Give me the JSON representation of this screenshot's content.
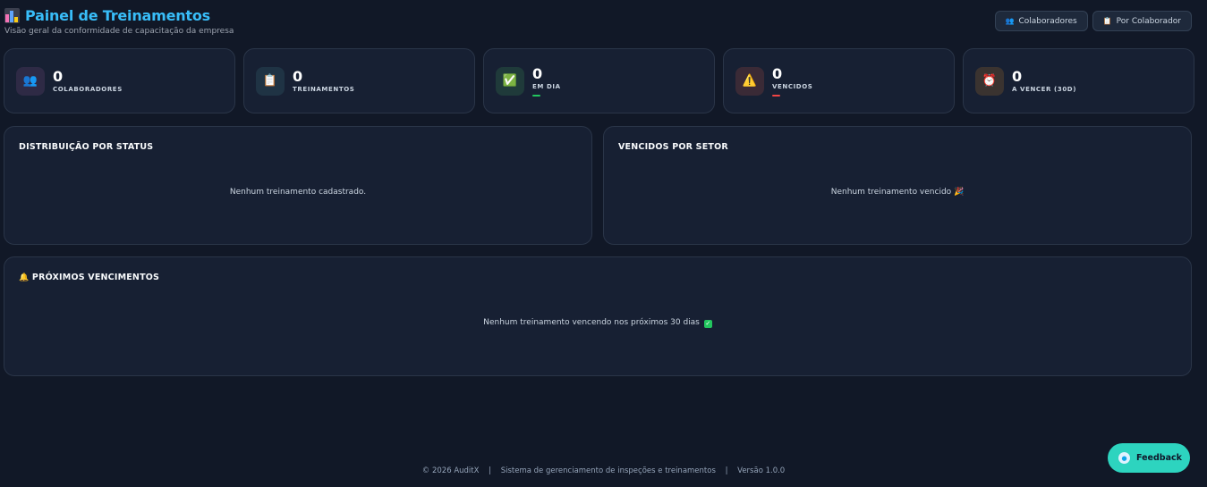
{
  "header": {
    "title": "Painel de Treinamentos",
    "subtitle": "Visão geral da conformidade de capacitação da empresa",
    "title_icon": "bar-chart-icon"
  },
  "actions": [
    {
      "label": "Colaboradores",
      "icon": "people-icon"
    },
    {
      "label": "Por Colaborador",
      "icon": "clipboard-icon"
    }
  ],
  "stats": [
    {
      "value": "0",
      "label": "COLABORADORES",
      "icon": "people-icon",
      "icon_glyph": "👥",
      "icon_bg": "#2e2a45",
      "bar_color": ""
    },
    {
      "value": "0",
      "label": "TREINAMENTOS",
      "icon": "clipboard-icon",
      "icon_glyph": "📋",
      "icon_bg": "#1f3344",
      "bar_color": ""
    },
    {
      "value": "0",
      "label": "EM DIA",
      "icon": "check-icon",
      "icon_glyph": "✅",
      "icon_bg": "#1f3a3a",
      "bar_color": "#22c55e"
    },
    {
      "value": "0",
      "label": "VENCIDOS",
      "icon": "warning-icon",
      "icon_glyph": "⚠️",
      "icon_bg": "#3a2a36",
      "bar_color": "#ef4444"
    },
    {
      "value": "0",
      "label": "A VENCER (30D)",
      "icon": "alarm-clock-icon",
      "icon_glyph": "⏰",
      "icon_bg": "#3a3330",
      "bar_color": ""
    }
  ],
  "panels": {
    "status": {
      "title": "DISTRIBUIÇÃO POR STATUS",
      "empty": "Nenhum treinamento cadastrado."
    },
    "setor": {
      "title": "VENCIDOS POR SETOR",
      "empty": "Nenhum treinamento vencido 🎉"
    },
    "proximos": {
      "title": "PRÓXIMOS VENCIMENTOS",
      "title_icon": "bell-icon",
      "empty": "Nenhum treinamento vencendo nos próximos 30 dias"
    }
  },
  "footer": {
    "copyright": "© 2026 AuditX",
    "system": "Sistema de gerenciamento de inspeções e treinamentos",
    "version": "Versão 1.0.0"
  },
  "feedback": {
    "label": "Feedback"
  },
  "colors": {
    "accent": "#38bdf8",
    "feedback": "#2dd4bf",
    "ok": "#22c55e",
    "danger": "#ef4444"
  }
}
